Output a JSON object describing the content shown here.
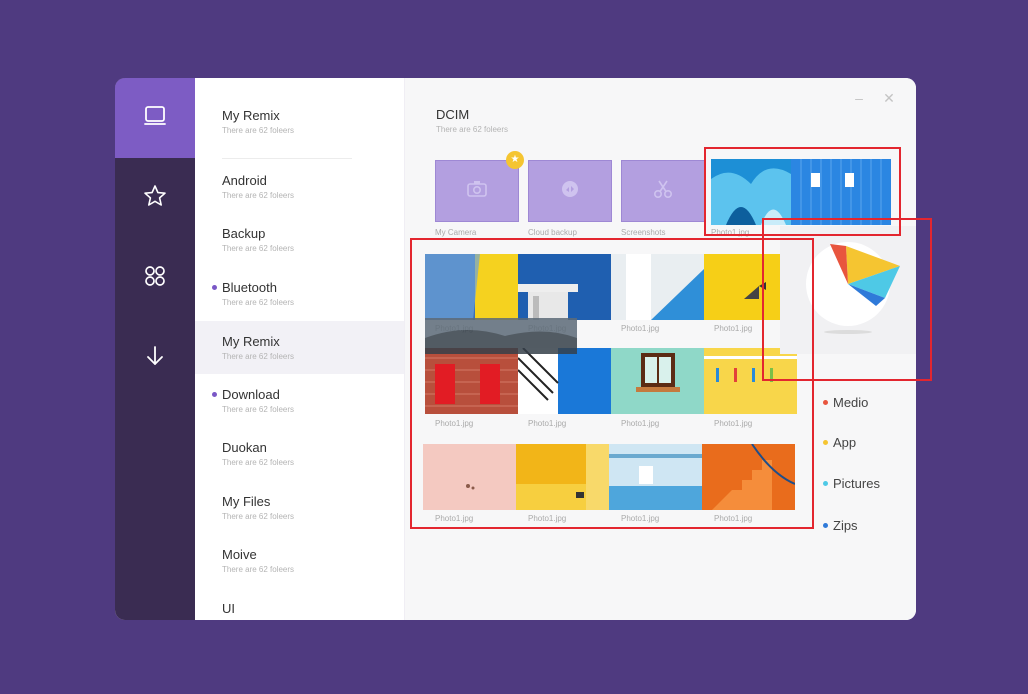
{
  "rail": {
    "items": [
      {
        "icon": "laptop-icon",
        "active": true
      },
      {
        "icon": "star-icon",
        "active": false
      },
      {
        "icon": "apps-grid-icon",
        "active": false
      },
      {
        "icon": "download-arrow-icon",
        "active": false
      }
    ]
  },
  "folders": [
    {
      "name": "My  Remix",
      "sub": "There are 62 foleers",
      "dot": false,
      "selected": false
    },
    {
      "name": "Android",
      "sub": "There are 62 foleers",
      "dot": false,
      "selected": false
    },
    {
      "name": "Backup",
      "sub": "There are 62 foleers",
      "dot": false,
      "selected": false
    },
    {
      "name": "Bluetooth",
      "sub": "There are 62 foleers",
      "dot": true,
      "selected": false
    },
    {
      "name": "My  Remix",
      "sub": "There are 62 foleers",
      "dot": false,
      "selected": true
    },
    {
      "name": "Download",
      "sub": "There are 62 foleers",
      "dot": true,
      "selected": false
    },
    {
      "name": "Duokan",
      "sub": "There are 62 foleers",
      "dot": false,
      "selected": false
    },
    {
      "name": "My  Files",
      "sub": "There are 62 foleers",
      "dot": false,
      "selected": false
    },
    {
      "name": "Moive",
      "sub": "There are 62 foleers",
      "dot": false,
      "selected": false
    },
    {
      "name": "UI",
      "sub": "",
      "dot": false,
      "selected": false
    }
  ],
  "main": {
    "title": "DCIM",
    "subtitle": "There are 62 foleers",
    "minimize": "–",
    "close": "✕",
    "albums": [
      {
        "label": "My Camera",
        "icon": "camera-icon"
      },
      {
        "label": "Cloud backup",
        "icon": "cloud-backup-icon"
      },
      {
        "label": "Screenshots",
        "icon": "scissors-icon"
      }
    ],
    "top_photo_label": "Photo1.jpg",
    "photo_label": "Photo1.jpg"
  },
  "legend": [
    {
      "label": "Medio",
      "color": "#e8553e"
    },
    {
      "label": "App",
      "color": "#f5c531"
    },
    {
      "label": "Pictures",
      "color": "#4ec9e6"
    },
    {
      "label": "Zips",
      "color": "#2f7ad9"
    }
  ],
  "colors": {
    "accent": "#7d5cc4",
    "rail": "#3a2c52",
    "selection": "#e3262f"
  }
}
